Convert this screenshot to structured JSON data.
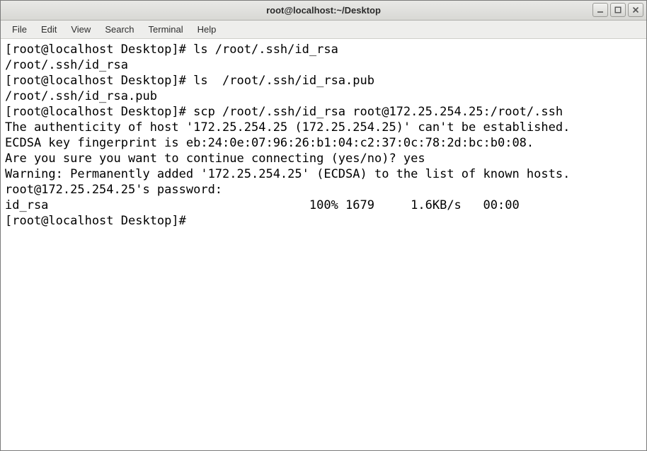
{
  "window": {
    "title": "root@localhost:~/Desktop"
  },
  "menubar": {
    "file": "File",
    "edit": "Edit",
    "view": "View",
    "search": "Search",
    "terminal": "Terminal",
    "help": "Help"
  },
  "term": {
    "l1": "[root@localhost Desktop]# ls /root/.ssh/id_rsa",
    "l2": "/root/.ssh/id_rsa",
    "l3": "[root@localhost Desktop]# ls  /root/.ssh/id_rsa.pub",
    "l4": "/root/.ssh/id_rsa.pub",
    "l5": "[root@localhost Desktop]# scp /root/.ssh/id_rsa root@172.25.254.25:/root/.ssh",
    "l6": "The authenticity of host '172.25.254.25 (172.25.254.25)' can't be established.",
    "l7": "ECDSA key fingerprint is eb:24:0e:07:96:26:b1:04:c2:37:0c:78:2d:bc:b0:08.",
    "l8": "Are you sure you want to continue connecting (yes/no)? yes",
    "l9": "Warning: Permanently added '172.25.254.25' (ECDSA) to the list of known hosts.",
    "l10": "root@172.25.254.25's password: ",
    "xfer_line": "id_rsa                                    100% 1679     1.6KB/s   00:00    ",
    "l12": "[root@localhost Desktop]# "
  }
}
